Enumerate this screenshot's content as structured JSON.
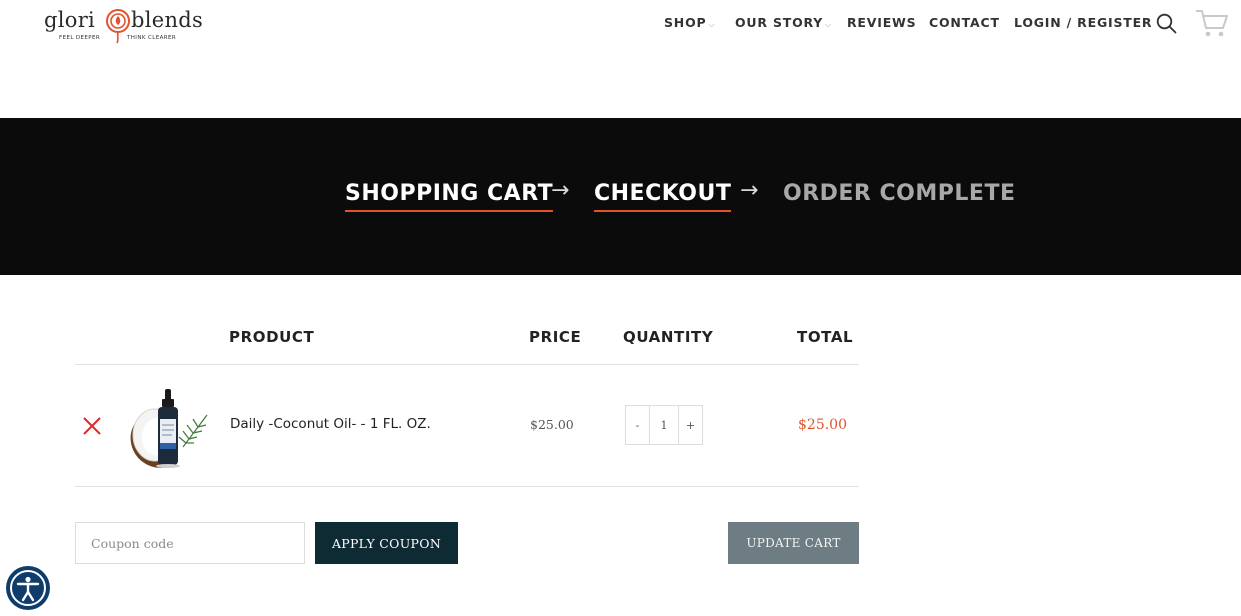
{
  "brand": {
    "name_left": "glori",
    "name_right": "blends",
    "tagline_left": "FEEL DEEPER",
    "tagline_right": "THINK CLEARER",
    "accent_color": "#e0532b"
  },
  "nav": {
    "items": [
      {
        "label": "SHOP",
        "has_dropdown": true
      },
      {
        "label": "OUR STORY",
        "has_dropdown": true
      },
      {
        "label": "REVIEWS",
        "has_dropdown": false
      },
      {
        "label": "CONTACT",
        "has_dropdown": false
      },
      {
        "label": "LOGIN / REGISTER",
        "has_dropdown": false
      }
    ],
    "caret": "⌵",
    "icons": [
      "search-icon",
      "cart-icon"
    ]
  },
  "steps": {
    "items": [
      {
        "label": "SHOPPING CART",
        "state": "active"
      },
      {
        "label": "CHECKOUT",
        "state": "active"
      },
      {
        "label": "ORDER COMPLETE",
        "state": "inactive"
      }
    ],
    "arrow": "→"
  },
  "cart": {
    "headers": {
      "product": "PRODUCT",
      "price": "PRICE",
      "quantity": "QUANTITY",
      "total": "TOTAL"
    },
    "items": [
      {
        "name": "Daily -Coconut Oil- - 1 FL. OZ.",
        "price": "$25.00",
        "quantity": "1",
        "total": "$25.00",
        "minus_label": "-",
        "plus_label": "+"
      }
    ],
    "coupon_placeholder": "Coupon code",
    "apply_coupon_label": "APPLY COUPON",
    "update_cart_label": "UPDATE CART"
  }
}
